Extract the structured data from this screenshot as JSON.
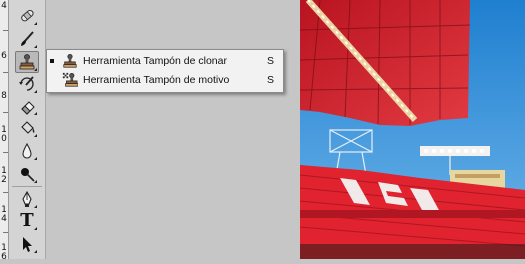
{
  "ruler": {
    "numbers": [
      "4",
      "6",
      "8",
      "1\n0",
      "1\n2",
      "1\n4",
      "1\n6"
    ]
  },
  "tools": [
    {
      "name": "healing-brush-icon"
    },
    {
      "name": "brush-icon"
    },
    {
      "name": "clone-stamp-icon",
      "selected": true
    },
    {
      "name": "history-brush-icon"
    },
    {
      "name": "eraser-icon"
    },
    {
      "name": "paint-bucket-icon"
    },
    {
      "name": "blur-drop-icon"
    },
    {
      "name": "dodge-icon"
    },
    {
      "name": "pen-icon"
    },
    {
      "name": "type-icon"
    },
    {
      "name": "path-selection-icon"
    }
  ],
  "flyout": {
    "items": [
      {
        "label": "Herramienta Tampón de clonar",
        "shortcut": "S",
        "active": true,
        "icon": "clone-stamp-icon"
      },
      {
        "label": "Herramienta Tampón de motivo",
        "shortcut": "S",
        "active": false,
        "icon": "pattern-stamp-icon"
      }
    ]
  },
  "type_tool_glyph": "T",
  "colors": {
    "sky": "#2d8fd6",
    "roof_red": "#d41e2a",
    "seats_red": "#e0232f",
    "panel_gray": "#d4d4d4"
  }
}
